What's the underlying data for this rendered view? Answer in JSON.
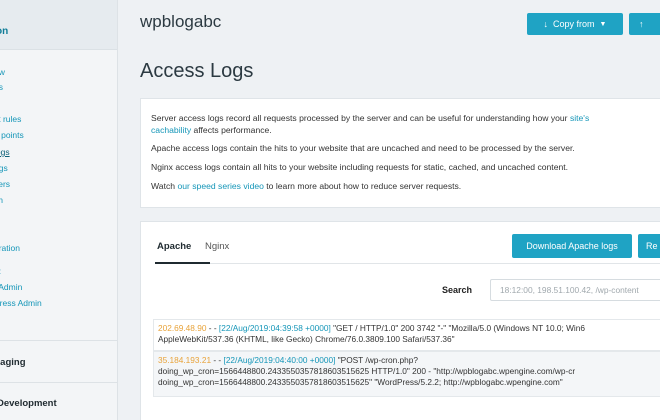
{
  "sidebar": {
    "header": "on",
    "links": [
      {
        "label": "ew",
        "active": false
      },
      {
        "label": "ns",
        "active": false
      },
      {
        "label": "ct rules",
        "active": false
      },
      {
        "label": "o points",
        "active": false
      },
      {
        "label": "logs",
        "active": true
      },
      {
        "label": "ogs",
        "active": false
      },
      {
        "label": "sers",
        "active": false
      },
      {
        "label": "sh",
        "active": false
      },
      {
        "label": "s",
        "active": false
      },
      {
        "label": "gration",
        "active": false
      },
      {
        "label": "o:",
        "active": false
      },
      {
        "label": "vAdmin",
        "active": false
      },
      {
        "label": "Press Admin",
        "active": false
      }
    ],
    "sections": [
      "taging",
      "Development"
    ]
  },
  "header": {
    "site_name": "wpblogabc",
    "copy_from_label": "Copy from",
    "extra_button_icon": "arrow-up-icon"
  },
  "page_title": "Access Logs",
  "info": {
    "line1_text": "Server access logs record all requests processed by the server and can be useful for understanding how your",
    "line1_link": "site's",
    "line2_link": "cachability",
    "line2_text": "affects performance.",
    "line3": "Apache access logs contain the hits to your website that are uncached and need to be processed by the server.",
    "line4": "Nginx access logs contain all hits to your website including requests for static, cached, and uncached content.",
    "line5_pre": "Watch",
    "line5_link": "our speed series video",
    "line5_post": "to learn more about how to reduce server requests."
  },
  "logs": {
    "tabs": [
      "Apache",
      "Nginx"
    ],
    "active_tab": "Apache",
    "download_label": "Download Apache logs",
    "refresh_label": "Re",
    "search_label": "Search",
    "search_placeholder": "18:12:00, 198.51.100.42, /wp-content",
    "rows": [
      {
        "ip": "202.69.48.90",
        "dash": " - - ",
        "date": "[22/Aug/2019:04:39:58 +0000]",
        "line1_rest": " \"GET / HTTP/1.0\" 200 3742 \"-\" \"Mozilla/5.0 (Windows NT 10.0; Win6",
        "line2": "AppleWebKit/537.36 (KHTML, like Gecko) Chrome/76.0.3809.100 Safari/537.36\""
      },
      {
        "ip": "35.184.193.21",
        "dash": " - - ",
        "date": "[22/Aug/2019:04:40:00 +0000]",
        "line1_rest": " \"POST /wp-cron.php?",
        "line2": "doing_wp_cron=1566448800.2433550357818603515625 HTTP/1.0\" 200 - \"http://wpblogabc.wpengine.com/wp-cr",
        "line3": "doing_wp_cron=1566448800.2433550357818603515625\" \"WordPress/5.2.2; http://wpblogabc.wpengine.com\""
      }
    ]
  },
  "colors": {
    "accent": "#1fa3c4",
    "link": "#1596b8",
    "ip": "#e8a33a"
  }
}
